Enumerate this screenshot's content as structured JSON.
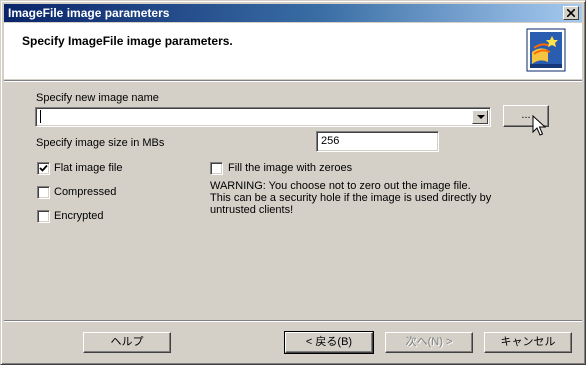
{
  "window": {
    "title": "ImageFile image parameters"
  },
  "header": {
    "title": "Specify ImageFile image parameters.",
    "logo_icon": "wizard-book-icon"
  },
  "form": {
    "image_name_label": "Specify new image name",
    "image_name_value": "",
    "browse_label": "...",
    "image_size_label": "Specify image size in MBs",
    "image_size_value": "256",
    "flat_image": {
      "label": "Flat image file",
      "checked": true
    },
    "compressed": {
      "label": "Compressed",
      "checked": false
    },
    "encrypted": {
      "label": "Encrypted",
      "checked": false
    },
    "fill_zeroes": {
      "label": "Fill the image with zeroes",
      "checked": false
    },
    "warning_lines": [
      "WARNING: You choose not to zero out the image file.",
      "This can be a security hole if the image is used directly by",
      "untrusted clients!"
    ]
  },
  "footer": {
    "help_label": "ヘルプ",
    "back_label": "< 戻る(B)",
    "next_label": "次へ(N) >",
    "cancel_label": "キャンセル"
  },
  "colors": {
    "titlebar_start": "#0a246a",
    "titlebar_end": "#a6caf0",
    "face": "#d4d0c8"
  }
}
